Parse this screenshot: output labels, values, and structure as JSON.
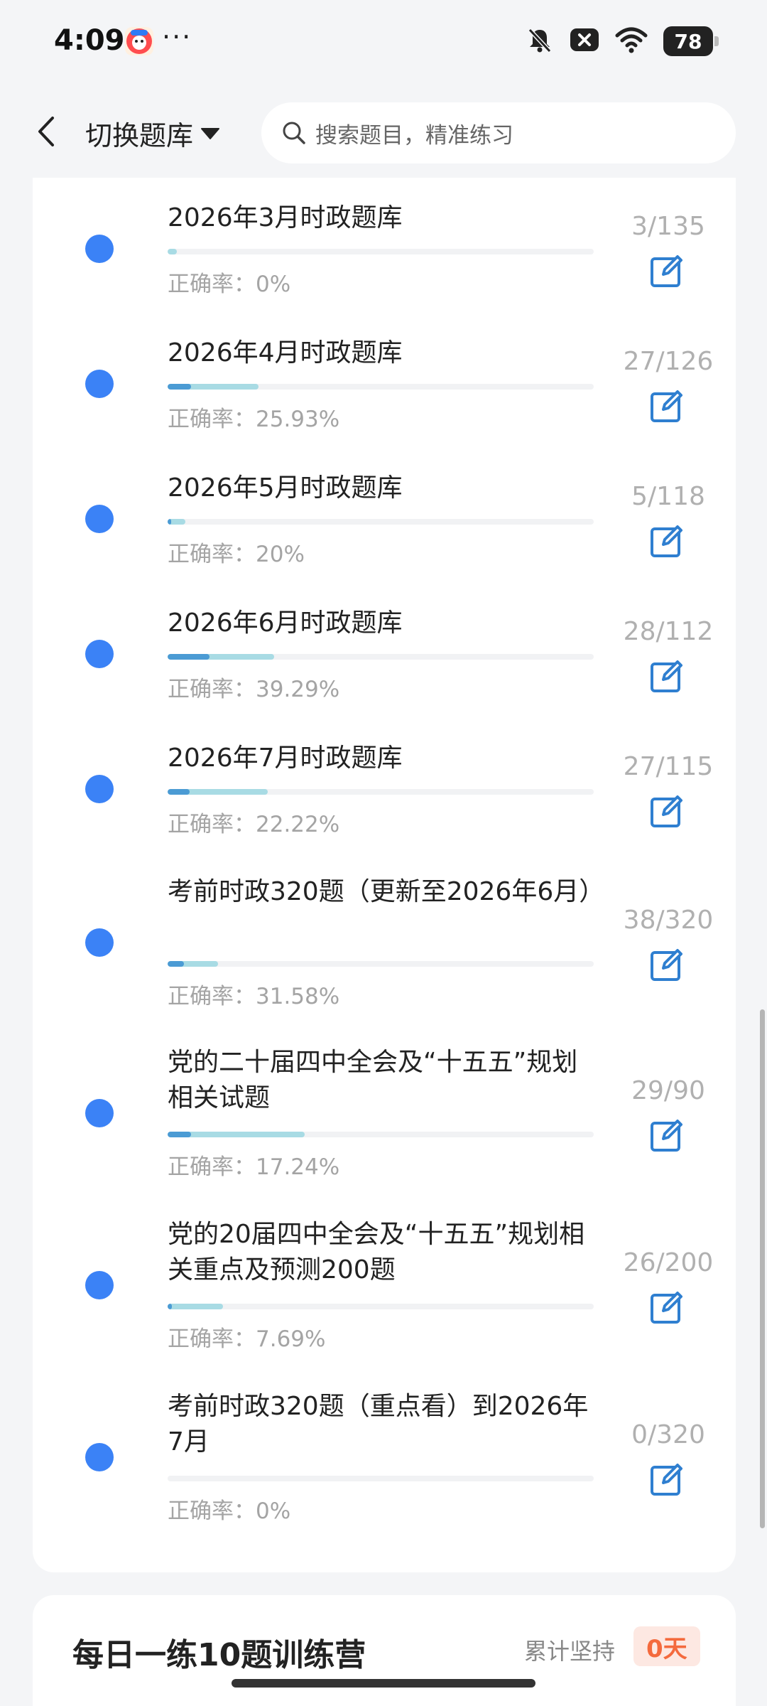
{
  "status_bar": {
    "time": "4:09",
    "more": "···",
    "battery": "78"
  },
  "header": {
    "switch_label": "切换题库",
    "search_placeholder": "搜索题目，精准练习"
  },
  "items": [
    {
      "title": "2026年3月时政题库",
      "count": "3/135",
      "accuracy": "正确率：0%",
      "progress": 0.022,
      "accuracy_value": 0
    },
    {
      "title": "2026年4月时政题库",
      "count": "27/126",
      "accuracy": "正确率：25.93%",
      "progress": 0.214,
      "accuracy_value": 0.2593
    },
    {
      "title": "2026年5月时政题库",
      "count": "5/118",
      "accuracy": "正确率：20%",
      "progress": 0.042,
      "accuracy_value": 0.2
    },
    {
      "title": "2026年6月时政题库",
      "count": "28/112",
      "accuracy": "正确率：39.29%",
      "progress": 0.25,
      "accuracy_value": 0.3929
    },
    {
      "title": "2026年7月时政题库",
      "count": "27/115",
      "accuracy": "正确率：22.22%",
      "progress": 0.235,
      "accuracy_value": 0.2222
    },
    {
      "title": "考前时政320题（更新至2026年6月）",
      "count": "38/320",
      "accuracy": "正确率：31.58%",
      "progress": 0.119,
      "accuracy_value": 0.3158
    },
    {
      "title": "党的二十届四中全会及“十五五”规划相关试题",
      "count": "29/90",
      "accuracy": "正确率：17.24%",
      "progress": 0.322,
      "accuracy_value": 0.1724
    },
    {
      "title": "党的20届四中全会及“十五五”规划相关重点及预测200题",
      "count": "26/200",
      "accuracy": "正确率：7.69%",
      "progress": 0.13,
      "accuracy_value": 0.0769
    },
    {
      "title": "考前时政320题（重点看）到2026年7月",
      "count": "0/320",
      "accuracy": "正确率：0%",
      "progress": 0,
      "accuracy_value": 0
    }
  ],
  "daily": {
    "title": "每日一练10题训练营",
    "persist_label": "累计坚持",
    "days": "0天"
  },
  "colors": {
    "accent": "#3b82f6",
    "progress_dark": "#4b9bd4",
    "progress_light": "#a8dbe4",
    "badge_text": "#f46a3d"
  }
}
